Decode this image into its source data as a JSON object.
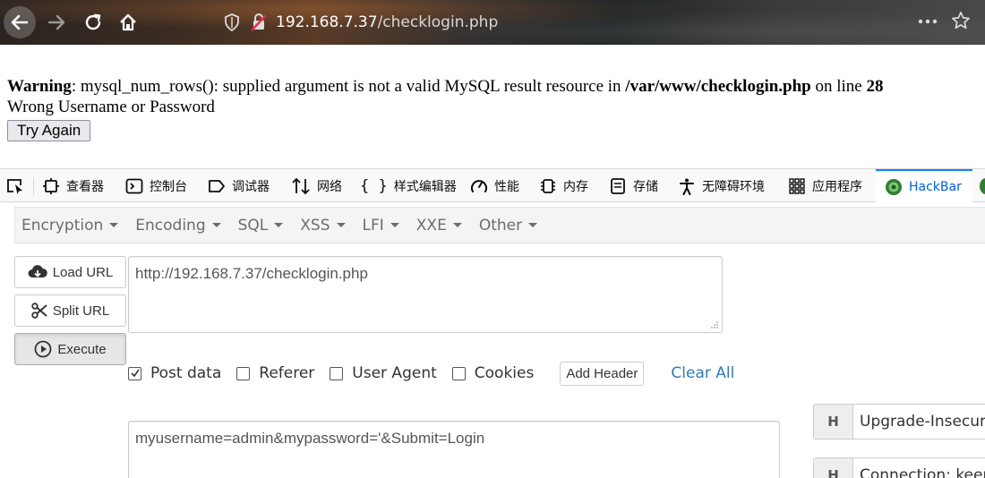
{
  "browser": {
    "url_host": "192.168.7.37",
    "url_path": "/checklogin.php"
  },
  "page": {
    "warning_label": "Warning",
    "warning_message": ": mysql_num_rows(): supplied argument is not a valid MySQL result resource in ",
    "warning_path": "/var/www/checklogin.php",
    "warning_on_line": " on line ",
    "warning_line_number": "28",
    "error_text": "Wrong Username or Password",
    "try_again_label": "Try Again"
  },
  "devtools": {
    "tabs": [
      {
        "label": "查看器",
        "icon": "inspector-icon"
      },
      {
        "label": "控制台",
        "icon": "console-icon"
      },
      {
        "label": "调试器",
        "icon": "debugger-icon"
      },
      {
        "label": "网络",
        "icon": "network-icon"
      },
      {
        "label": "样式编辑器",
        "icon": "style-editor-icon"
      },
      {
        "label": "性能",
        "icon": "performance-icon"
      },
      {
        "label": "内存",
        "icon": "memory-icon"
      },
      {
        "label": "存储",
        "icon": "storage-icon"
      },
      {
        "label": "无障碍环境",
        "icon": "accessibility-icon"
      },
      {
        "label": "应用程序",
        "icon": "application-icon"
      },
      {
        "label": "HackBar",
        "icon": "hackbar-icon",
        "active": true
      }
    ]
  },
  "hackbar": {
    "menu": [
      "Encryption",
      "Encoding",
      "SQL",
      "XSS",
      "LFI",
      "XXE",
      "Other"
    ],
    "load_url_label": "Load URL",
    "split_url_label": "Split URL",
    "execute_label": "Execute",
    "url_value": "http://192.168.7.37/checklogin.php",
    "options": [
      {
        "label": "Post data",
        "checked": true
      },
      {
        "label": "Referer",
        "checked": false
      },
      {
        "label": "User Agent",
        "checked": false
      },
      {
        "label": "Cookies",
        "checked": false
      }
    ],
    "add_header_label": "Add Header",
    "clear_all_label": "Clear All",
    "post_body": "myusername=admin&mypassword='&Submit=Login",
    "headers": [
      {
        "badge": "H",
        "value": "Upgrade-Insecure"
      },
      {
        "badge": "H",
        "value": "Connection: keep-"
      }
    ]
  },
  "colors": {
    "accent": "#0a84ff",
    "link": "#337ab7",
    "active_tab_text": "#0060df"
  }
}
